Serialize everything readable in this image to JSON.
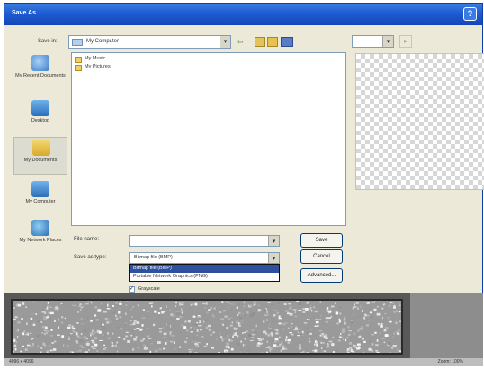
{
  "dialog": {
    "title": "Save As",
    "help_glyph": "?"
  },
  "toolbar": {
    "look_in_label": "Save in:",
    "look_in_value": "My Computer",
    "dropdown_glyph": "▾",
    "back_glyph": "⇦",
    "preview_glyph": "▸"
  },
  "places": [
    {
      "label": "My Recent Documents",
      "icon": "recent-documents-icon"
    },
    {
      "label": "Desktop",
      "icon": "desktop-icon"
    },
    {
      "label": "My Documents",
      "icon": "my-documents-icon"
    },
    {
      "label": "My Computer",
      "icon": "my-computer-icon"
    },
    {
      "label": "My Network Places",
      "icon": "network-places-icon"
    }
  ],
  "files": [
    {
      "name": "My Music"
    },
    {
      "name": "My Pictures"
    }
  ],
  "form": {
    "filename_label": "File name:",
    "filename_value": "",
    "format_label": "Save as type:",
    "format_value": "Bitmap file (BMP)",
    "format_options": [
      "Bitmap file (BMP)",
      "Portable Network Graphics (PNG)"
    ],
    "lossless_label": "Grayscale",
    "lossless_checked": "✓"
  },
  "buttons": {
    "save": "Save",
    "cancel": "Cancel",
    "advanced": "Advanced..."
  },
  "status": {
    "left": "4096 x 4096",
    "right": "Zoom: 100%"
  },
  "colors": {
    "titlebar": "#1d5bd3",
    "dialog_bg": "#ece9d8",
    "selection": "#2d50a0"
  }
}
